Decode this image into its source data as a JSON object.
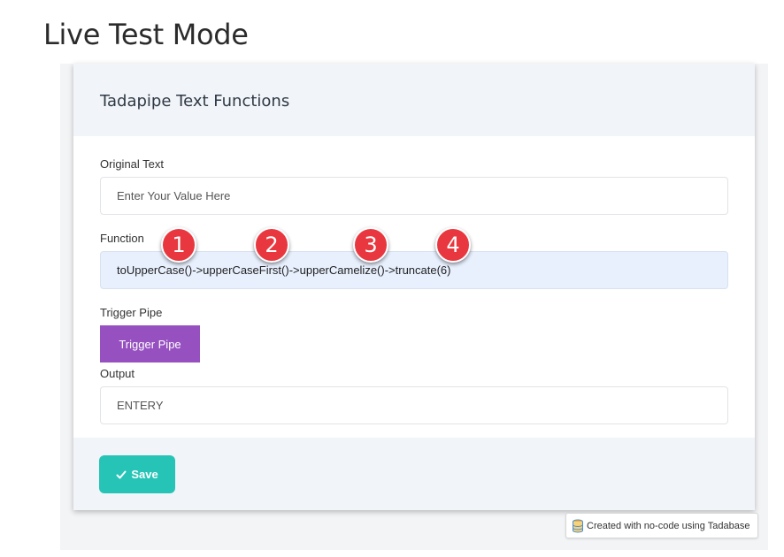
{
  "page": {
    "title": "Live Test Mode"
  },
  "card": {
    "title": "Tadapipe Text Functions",
    "original_text": {
      "label": "Original Text",
      "placeholder": "Enter Your Value Here"
    },
    "function": {
      "label": "Function",
      "value": "toUpperCase()->upperCaseFirst()->upperCamelize()->truncate(6)"
    },
    "badges": [
      "1",
      "2",
      "3",
      "4"
    ],
    "trigger": {
      "label": "Trigger Pipe",
      "button_label": "Trigger Pipe"
    },
    "output": {
      "label": "Output",
      "value": "ENTERY"
    },
    "save_label": "Save"
  },
  "footer_credit": {
    "text": "Created with no-code using Tadabase"
  },
  "colors": {
    "badge": "#e8373f",
    "trigger_button": "#9650c0",
    "save_button": "#25c4b7",
    "function_field": "#e8f0fe"
  },
  "icons": {
    "save": "check-icon",
    "credit": "database-icon"
  }
}
